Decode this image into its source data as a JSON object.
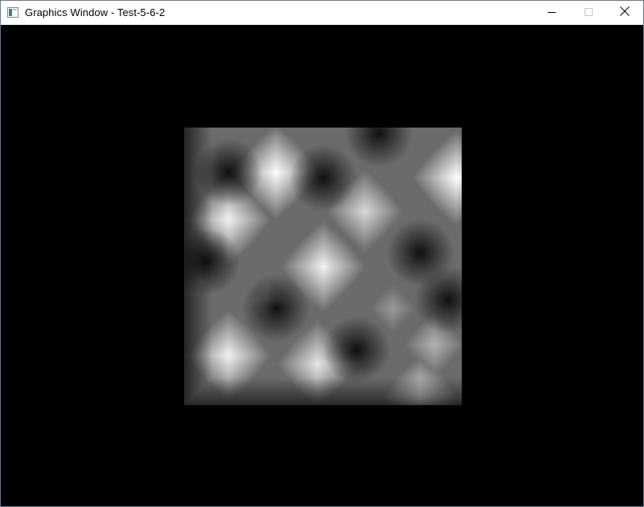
{
  "window": {
    "title": "Graphics Window - Test-5-6-2",
    "buttons": {
      "minimize": "minimize-icon",
      "maximize": "maximize-icon",
      "close": "close-icon"
    }
  },
  "viewport": {
    "background": "#000000",
    "content": "grayscale procedural noise texture"
  },
  "colors": {
    "titlebar_bg": "#ffffff",
    "title_text": "#000000",
    "window_border": "#6b7a8c",
    "viewport_bg": "#000000"
  }
}
